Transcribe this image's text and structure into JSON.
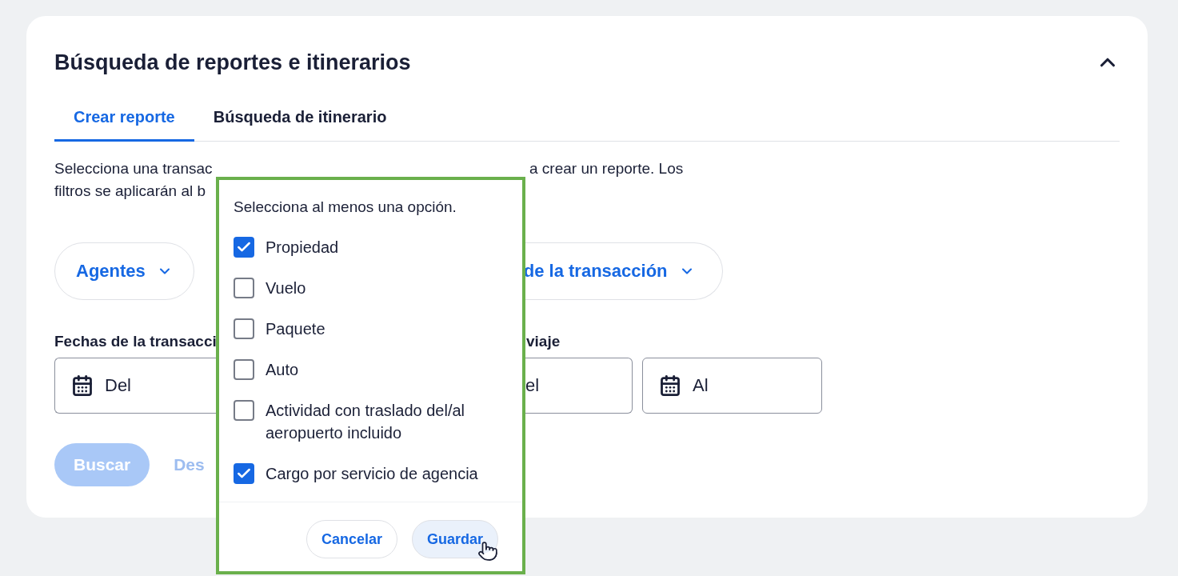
{
  "card": {
    "title": "Búsqueda de reportes e itinerarios",
    "expanded": true
  },
  "tabs": [
    {
      "label": "Crear reporte",
      "selected": true
    },
    {
      "label": "Búsqueda de itinerario",
      "selected": false
    }
  ],
  "description": {
    "line_1_start": "Selecciona una transac",
    "line_1_end": "a crear un reporte. Los",
    "line_2_start": "filtros se aplicarán al b"
  },
  "filters": [
    {
      "label": "Agentes"
    },
    {
      "label": "de la transacción"
    }
  ],
  "date_labels": [
    "Fechas de la transacci",
    "viaje"
  ],
  "date_fields": [
    {
      "placeholder": "Del"
    },
    {
      "placeholder": "el"
    },
    {
      "placeholder": "Al"
    }
  ],
  "actions": [
    {
      "label": "Buscar",
      "kind": "primary",
      "disabled": true
    },
    {
      "label": "Des",
      "kind": "secondary",
      "disabled": true
    }
  ],
  "popover": {
    "instruction": "Selecciona al menos una opción.",
    "options": [
      {
        "label": "Propiedad",
        "checked": true
      },
      {
        "label": "Vuelo",
        "checked": false
      },
      {
        "label": "Paquete",
        "checked": false
      },
      {
        "label": "Auto",
        "checked": false
      },
      {
        "label": "Actividad con traslado del/al aeropuerto incluido",
        "checked": false
      },
      {
        "label": "Cargo por servicio de agencia",
        "checked": true
      }
    ],
    "buttons": [
      {
        "label": "Cancelar",
        "kind": "secondary"
      },
      {
        "label": "Guardar",
        "kind": "primary"
      }
    ]
  }
}
